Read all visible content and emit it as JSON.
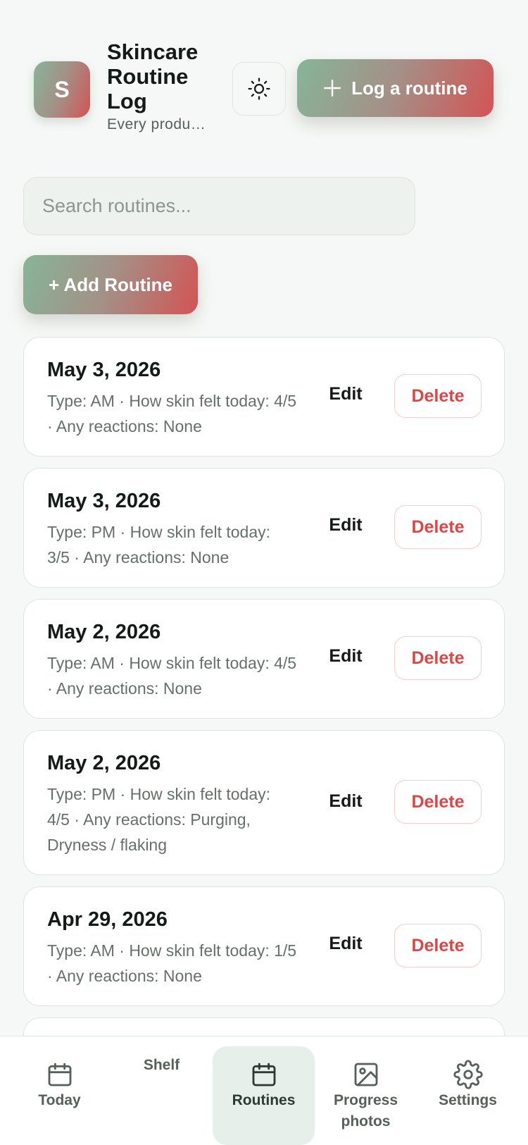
{
  "header": {
    "avatar_letter": "S",
    "title": "Skincare Routine Log",
    "subtitle": "Every produ…",
    "theme_icon": "sun-icon",
    "log_button_label": "Log a routine",
    "log_button_icon": "plus-icon"
  },
  "search": {
    "placeholder": "Search routines..."
  },
  "add_button_label": "+ Add Routine",
  "routines": [
    {
      "date": "May 3, 2026",
      "details": "Type: AM · How skin felt today: 4/5 · Any reactions: None",
      "edit": "Edit",
      "delete": "Delete"
    },
    {
      "date": "May 3, 2026",
      "details": "Type: PM · How skin felt today: 3/5 · Any reactions: None",
      "edit": "Edit",
      "delete": "Delete"
    },
    {
      "date": "May 2, 2026",
      "details": "Type: AM · How skin felt today: 4/5 · Any reactions: None",
      "edit": "Edit",
      "delete": "Delete"
    },
    {
      "date": "May 2, 2026",
      "details": "Type: PM · How skin felt today: 4/5 · Any reactions: Purging, Dryness / flaking",
      "edit": "Edit",
      "delete": "Delete"
    },
    {
      "date": "Apr 29, 2026",
      "details": "Type: AM · How skin felt today: 1/5 · Any reactions: None",
      "edit": "Edit",
      "delete": "Delete"
    }
  ],
  "nav": {
    "items": [
      {
        "label": "Today",
        "icon": "calendar-icon"
      },
      {
        "label": "Shelf",
        "icon": ""
      },
      {
        "label": "Routines",
        "icon": "calendar-icon",
        "active": true
      },
      {
        "label": "Progress photos",
        "icon": "image-icon"
      },
      {
        "label": "Settings",
        "icon": "gear-icon"
      }
    ]
  },
  "colors": {
    "gradient_start": "#86b597",
    "gradient_end": "#d35454",
    "delete_red": "#e04545",
    "background": "#f5f8f6"
  }
}
